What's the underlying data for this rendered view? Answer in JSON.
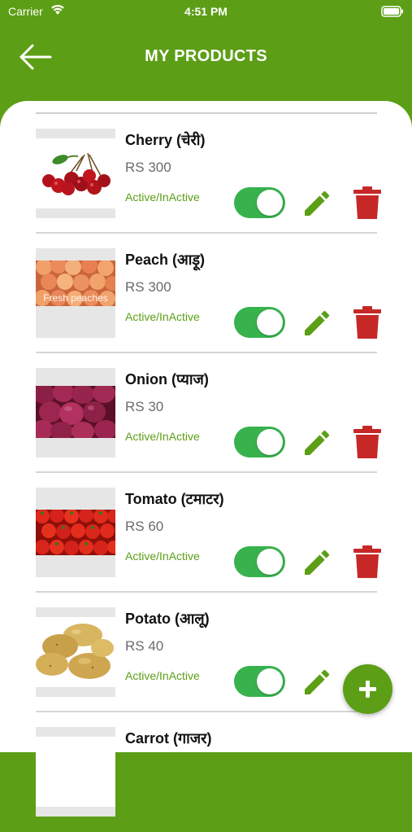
{
  "status_bar": {
    "carrier": "Carrier",
    "time": "4:51 PM"
  },
  "header": {
    "title": "MY PRODUCTS",
    "back_icon": "arrow-left-icon"
  },
  "products": [
    {
      "name": "Cherry (चेरी)",
      "price": "RS 300",
      "status": "Active/InActive",
      "active": true,
      "image": "cherry-image"
    },
    {
      "name": "Peach (आड़ू)",
      "price": "RS 300",
      "status": "Active/InActive",
      "active": true,
      "image": "peach-image",
      "image_caption": "Fresh peaches"
    },
    {
      "name": "Onion (प्याज)",
      "price": "RS 30",
      "status": "Active/InActive",
      "active": true,
      "image": "onion-image"
    },
    {
      "name": "Tomato (टमाटर)",
      "price": "RS 60",
      "status": "Active/InActive",
      "active": true,
      "image": "tomato-image"
    },
    {
      "name": "Potato (आलू)",
      "price": "RS 40",
      "status": "Active/InActive",
      "active": true,
      "image": "potato-image"
    },
    {
      "name": "Carrot (गाजर)",
      "price": "",
      "status": "",
      "active": true,
      "image": "carrot-image"
    }
  ],
  "colors": {
    "brand_green": "#5c9e16",
    "toggle_on": "#37b24d",
    "delete_red": "#c62828"
  },
  "fab": {
    "icon": "plus-icon"
  }
}
